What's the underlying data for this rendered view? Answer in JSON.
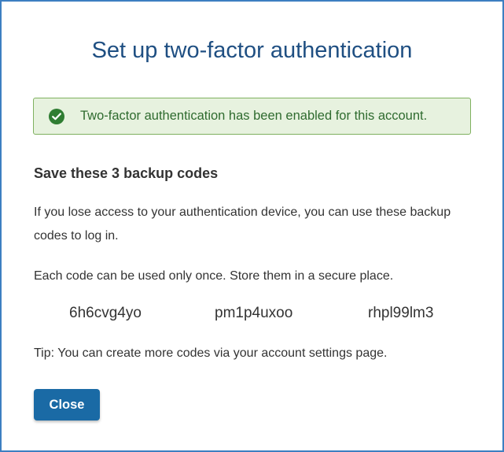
{
  "dialog": {
    "title": "Set up two-factor authentication",
    "alert": {
      "icon": "check-circle-icon",
      "message": "Two-factor authentication has been enabled for this account.",
      "color": "#2f7d32",
      "background": "#e7f2df"
    },
    "heading": "Save these 3 backup codes",
    "paragraph_lose_access": "If you lose access to your authentication device, you can use these backup codes to log in.",
    "paragraph_once": "Each code can be used only once. Store them in a secure place.",
    "backup_codes": [
      "6h6cvg4yo",
      "pm1p4uxoo",
      "rhpl99lm3"
    ],
    "tip": "Tip: You can create more codes via your account settings page.",
    "close_label": "Close",
    "accent_color": "#1a6aa5",
    "title_color": "#1f4f82"
  }
}
